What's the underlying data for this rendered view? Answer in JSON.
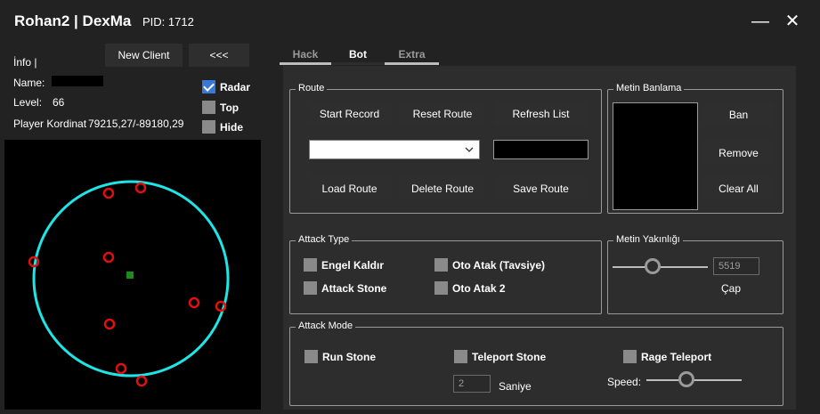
{
  "window": {
    "title": "Rohan2 | DexMa",
    "pid": "PID: 1712",
    "minimize_glyph": "—",
    "close_glyph": "✕"
  },
  "left": {
    "info": "İnfo |",
    "new_client": "New Client",
    "collapse": "<<<",
    "name_label": "Name:",
    "level_label": "Level:",
    "level_value": "66",
    "coord_label": "Player Kordinat",
    "coord_value": "79215,27/-89180,29",
    "checks": [
      {
        "label": "Radar",
        "checked": true
      },
      {
        "label": "Top",
        "checked": false
      },
      {
        "label": "Hide",
        "checked": false
      }
    ]
  },
  "radar": {
    "circle_color": "#1ee6e6",
    "marker_color": "#e01010",
    "player_color": "#1a8c1a"
  },
  "tabs": [
    {
      "label": "Hack",
      "active": false
    },
    {
      "label": "Bot",
      "active": true
    },
    {
      "label": "Extra",
      "active": false
    }
  ],
  "route": {
    "title": "Route",
    "start_record": "Start Record",
    "reset_route": "Reset Route",
    "refresh_list": "Refresh List",
    "load_route": "Load Route",
    "delete_route": "Delete Route",
    "save_route": "Save Route",
    "select_value": "",
    "text_value": ""
  },
  "metin_ban": {
    "title": "Metin Banlama",
    "ban": "Ban",
    "remove": "Remove",
    "clear_all": "Clear All"
  },
  "attack_type": {
    "title": "Attack Type",
    "options": [
      "Engel Kaldır",
      "Oto Atak (Tavsiye)",
      "Attack Stone",
      "Oto Atak 2"
    ]
  },
  "metin_yakinligi": {
    "title": "Metin Yakınlığı",
    "value": "5519",
    "cap_label": "Çap",
    "slider_fraction": 0.4
  },
  "attack_mode": {
    "title": "Attack Mode",
    "run_stone": "Run Stone",
    "teleport_stone": "Teleport Stone",
    "rage_teleport": "Rage Teleport",
    "saniye_value": "2",
    "saniye_label": "Saniye",
    "speed_label": "Speed:",
    "speed_fraction": 0.4
  }
}
